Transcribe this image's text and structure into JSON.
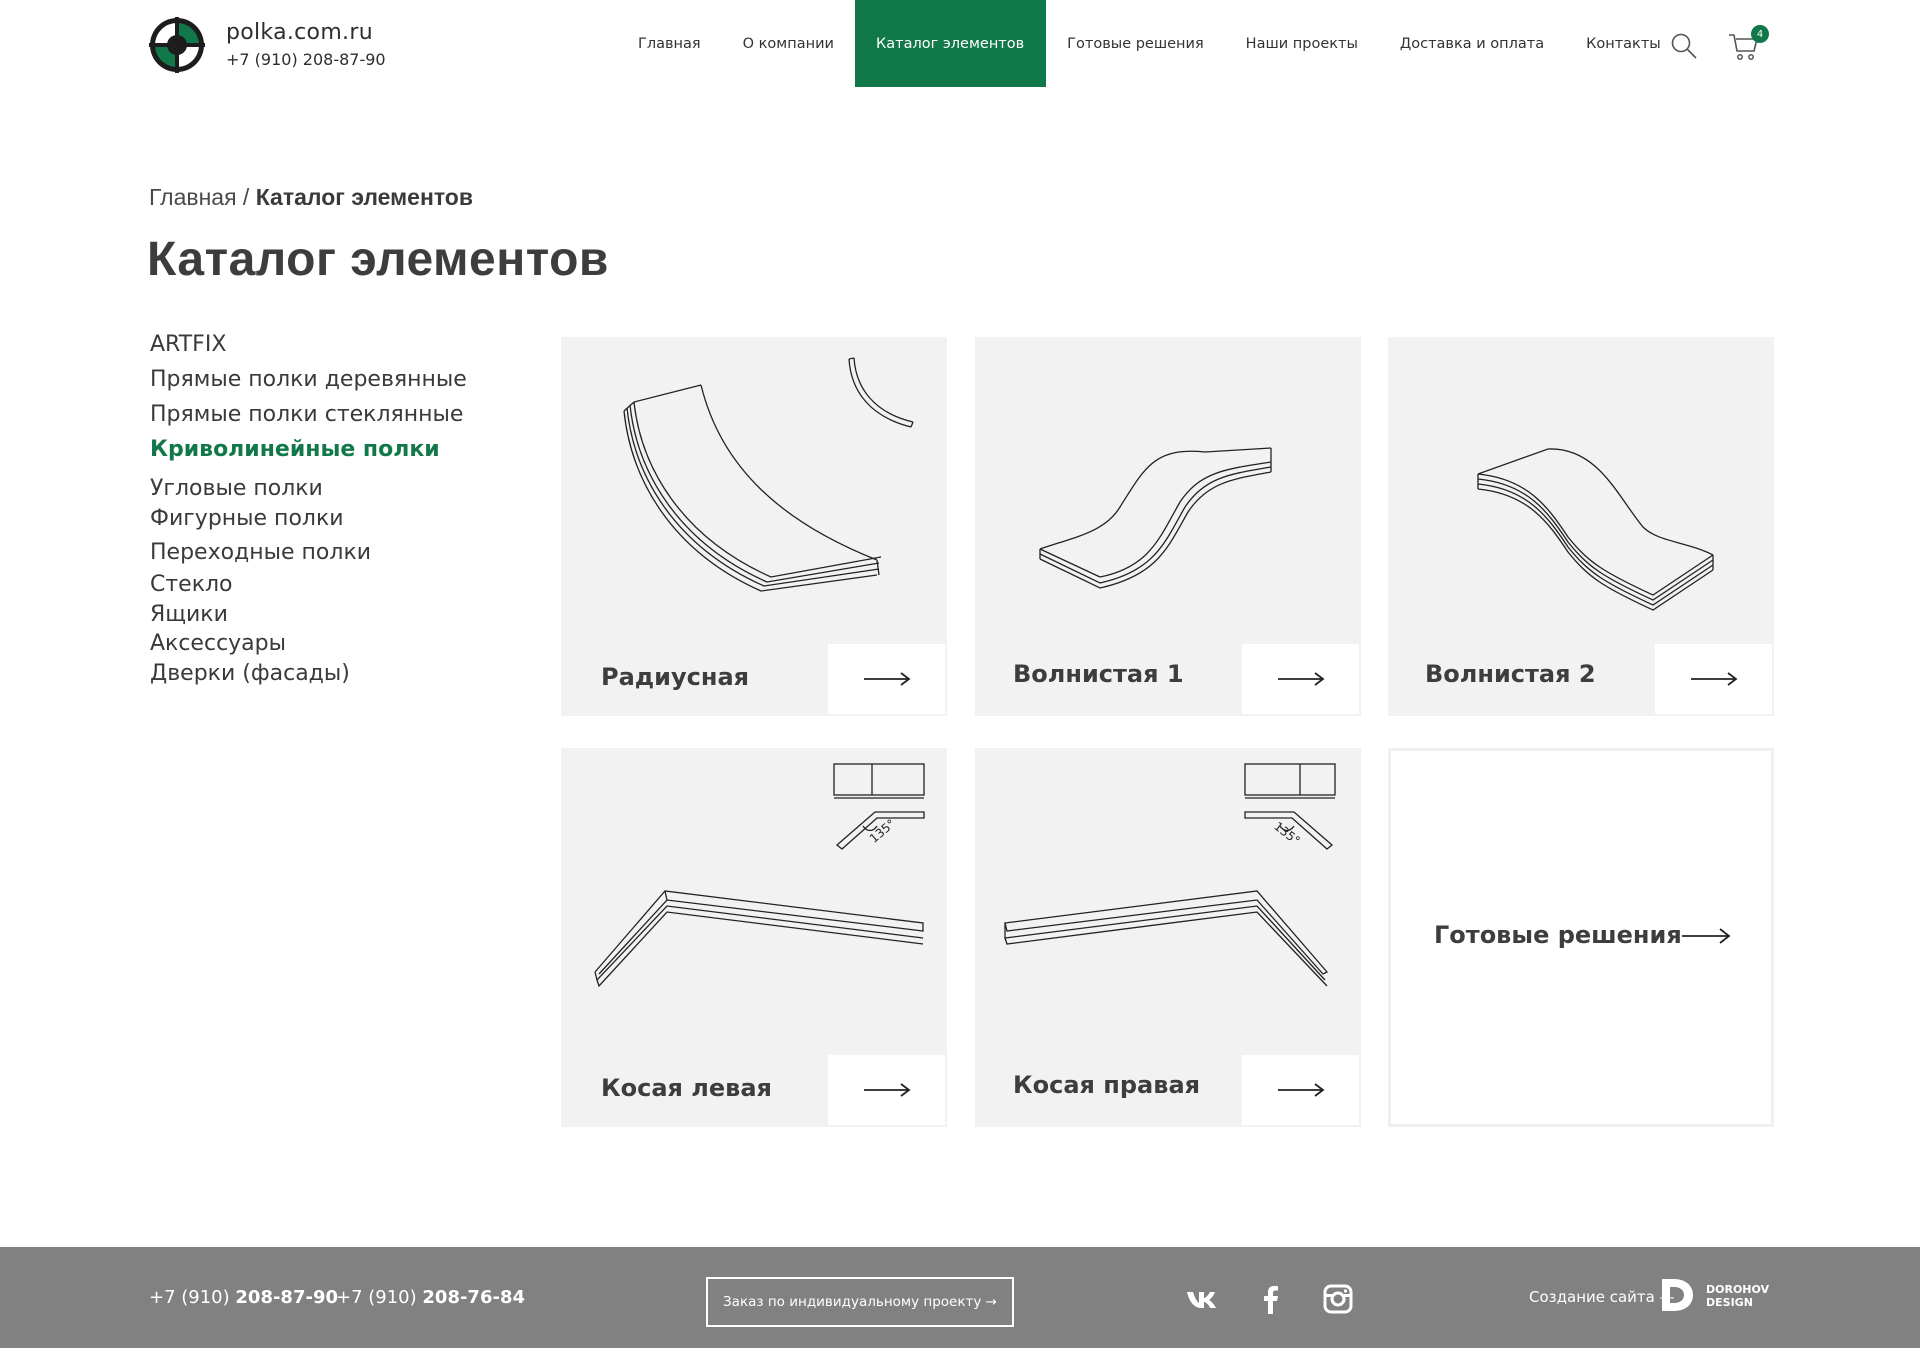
{
  "header": {
    "site_name": "polka.com.ru",
    "phone": "+7 (910) 208-87-90",
    "nav": [
      {
        "label": "Главная",
        "active": false
      },
      {
        "label": "О компании",
        "active": false
      },
      {
        "label": "Каталог элементов",
        "active": true
      },
      {
        "label": "Готовые решения",
        "active": false
      },
      {
        "label": "Наши проекты",
        "active": false
      },
      {
        "label": "Доставка и оплата",
        "active": false
      },
      {
        "label": "Контакты",
        "active": false
      }
    ],
    "cart_count": "4",
    "icons": {
      "search": "search-icon",
      "cart": "cart-icon"
    }
  },
  "breadcrumb": {
    "home": "Главная",
    "separator": " / ",
    "current": "Каталог элементов"
  },
  "page_title": "Каталог элементов",
  "sidebar": {
    "items": [
      {
        "label": "ARTFIX",
        "active": false
      },
      {
        "label": "Прямые полки деревянные",
        "active": false
      },
      {
        "label": "Прямые полки стеклянные",
        "active": false
      },
      {
        "label": "Криволинейные полки",
        "active": true
      },
      {
        "label": "Угловые полки",
        "active": false
      },
      {
        "label": "Фигурные полки",
        "active": false
      },
      {
        "label": "Переходные полки",
        "active": false
      },
      {
        "label": "Стекло",
        "active": false
      },
      {
        "label": "Ящики",
        "active": false
      },
      {
        "label": "Аксессуары",
        "active": false
      },
      {
        "label": "Дверки (фасады)",
        "active": false
      }
    ]
  },
  "cards": [
    {
      "label": "Радиусная",
      "icon": "radius-shelf-drawing"
    },
    {
      "label": "Волнистая 1",
      "icon": "wavy-shelf-drawing"
    },
    {
      "label": "Волнистая 2",
      "icon": "wavy-shelf-drawing"
    },
    {
      "label": "Косая левая",
      "icon": "angled-left-shelf-drawing",
      "angle_label": "135°"
    },
    {
      "label": "Косая правая",
      "icon": "angled-right-shelf-drawing",
      "angle_label": "135°"
    }
  ],
  "ready_card": {
    "label": "Готовые решения"
  },
  "footer": {
    "phone1_prefix": "+7 (910) ",
    "phone1_number": "208-87-90",
    "phone2_prefix": "+7 (910) ",
    "phone2_number": "208-76-84",
    "order_button": "Заказ по индивидуальному проекту  →",
    "social": [
      "vk-icon",
      "facebook-icon",
      "instagram-icon"
    ],
    "credit": "Создание сайта —",
    "studio_line1": "DOROHOV",
    "studio_line2": "DESIGN"
  },
  "colors": {
    "accent": "#11784a",
    "footer_bg": "#818182",
    "card_bg": "#f2f2f2",
    "text": "#3a3a3a"
  }
}
